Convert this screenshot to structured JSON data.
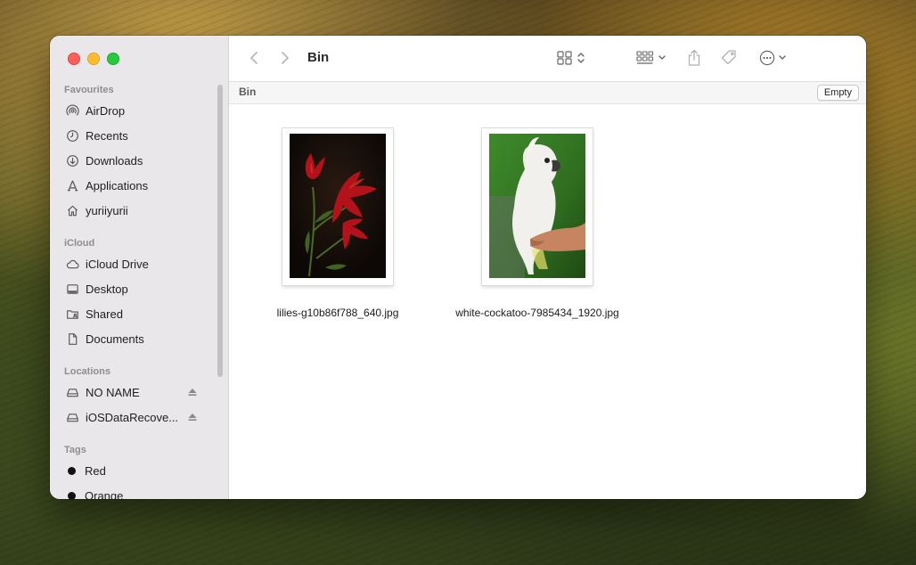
{
  "window": {
    "title": "Bin"
  },
  "sidebar": {
    "sections": {
      "favourites": "Favourites",
      "icloud": "iCloud",
      "locations": "Locations",
      "tags": "Tags"
    },
    "favourites": [
      {
        "label": "AirDrop",
        "icon": "airdrop-icon"
      },
      {
        "label": "Recents",
        "icon": "clock-icon"
      },
      {
        "label": "Downloads",
        "icon": "download-icon"
      },
      {
        "label": "Applications",
        "icon": "applications-icon"
      },
      {
        "label": "yuriiyurii",
        "icon": "home-icon"
      }
    ],
    "icloud": [
      {
        "label": "iCloud Drive",
        "icon": "cloud-icon"
      },
      {
        "label": "Desktop",
        "icon": "desktop-icon"
      },
      {
        "label": "Shared",
        "icon": "shared-folder-icon"
      },
      {
        "label": "Documents",
        "icon": "document-icon"
      }
    ],
    "locations": [
      {
        "label": "NO NAME",
        "icon": "drive-icon",
        "ejectable": true
      },
      {
        "label": "iOSDataRecove...",
        "icon": "drive-icon",
        "ejectable": true
      }
    ],
    "tags": [
      {
        "label": "Red",
        "color": "#111111"
      },
      {
        "label": "Orange",
        "color": "#111111"
      }
    ]
  },
  "pathbar": {
    "label": "Bin",
    "empty_button": "Empty"
  },
  "files": [
    {
      "name": "lilies-g10b86f788_640.jpg",
      "thumbnail": "red-lilies-photo"
    },
    {
      "name": "white-cockatoo-7985434_1920.jpg",
      "thumbnail": "white-cockatoo-photo"
    }
  ]
}
